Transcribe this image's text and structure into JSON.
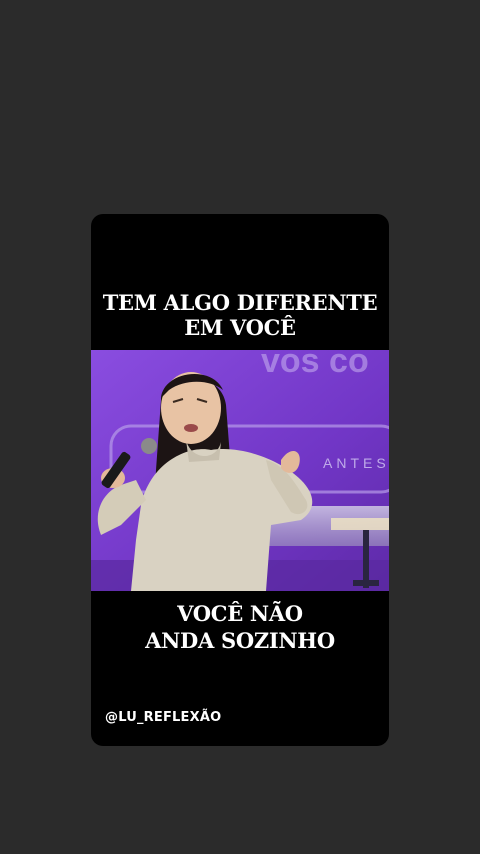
{
  "background_color": "#2b2b2b",
  "card": {
    "caption_top_lines": [
      "TEM ALGO DIFERENTE",
      "EM VOCÊ"
    ],
    "caption_bottom_lines": [
      "VOCÊ NÃO",
      "ANDA SOZINHO"
    ],
    "handle": "@LU_REFLEXÃO",
    "video": {
      "backdrop_color": "#7b3fd0",
      "screen_text": "ANTES",
      "subject": "woman-speaking-with-microphone"
    }
  }
}
